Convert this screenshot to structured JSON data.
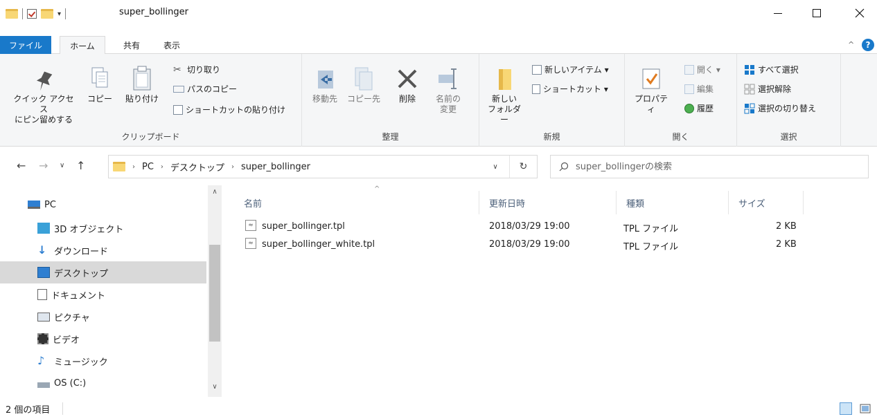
{
  "window": {
    "title": "super_bollinger",
    "qat_dropdown": "▾"
  },
  "tabs": [
    {
      "label": "ファイル"
    },
    {
      "label": "ホーム"
    },
    {
      "label": "共有"
    },
    {
      "label": "表示"
    }
  ],
  "ribbon": {
    "clipboard": {
      "pin_label_1": "クイック アクセス",
      "pin_label_2": "にピン留めする",
      "copy_label": "コピー",
      "paste_label": "貼り付け",
      "cut_label": "切り取り",
      "copy_path_label": "パスのコピー",
      "paste_shortcut_label": "ショートカットの貼り付け",
      "group_label": "クリップボード"
    },
    "organize": {
      "move_label": "移動先",
      "copyto_label": "コピー先",
      "delete_label": "削除",
      "rename_label_1": "名前の",
      "rename_label_2": "変更",
      "group_label": "整理"
    },
    "new": {
      "new_folder_label_1": "新しい",
      "new_folder_label_2": "フォルダー",
      "new_item_label": "新しいアイテム ▾",
      "shortcut_label": "ショートカット ▾",
      "group_label": "新規"
    },
    "open": {
      "properties_label": "プロパティ",
      "open_label": "開く ▾",
      "edit_label": "編集",
      "history_label": "履歴",
      "group_label": "開く"
    },
    "select": {
      "select_all_label": "すべて選択",
      "select_none_label": "選択解除",
      "invert_label": "選択の切り替え",
      "group_label": "選択"
    }
  },
  "address": {
    "crumbs": [
      "PC",
      "デスクトップ",
      "super_bollinger"
    ],
    "search_placeholder": "super_bollingerの検索"
  },
  "nav": {
    "items": [
      {
        "label": "PC"
      },
      {
        "label": "3D オブジェクト"
      },
      {
        "label": "ダウンロード"
      },
      {
        "label": "デスクトップ"
      },
      {
        "label": "ドキュメント"
      },
      {
        "label": "ピクチャ"
      },
      {
        "label": "ビデオ"
      },
      {
        "label": "ミュージック"
      },
      {
        "label": "OS (C:)"
      }
    ]
  },
  "files": {
    "columns": {
      "name": "名前",
      "modified": "更新日時",
      "type": "種類",
      "size": "サイズ"
    },
    "rows": [
      {
        "name": "super_bollinger.tpl",
        "modified": "2018/03/29 19:00",
        "type": "TPL ファイル",
        "size": "2 KB"
      },
      {
        "name": "super_bollinger_white.tpl",
        "modified": "2018/03/29 19:00",
        "type": "TPL ファイル",
        "size": "2 KB"
      }
    ]
  },
  "status": {
    "count": "2 個の項目"
  },
  "colors": {
    "accent": "#1979ca",
    "folder": "#f8d775"
  }
}
